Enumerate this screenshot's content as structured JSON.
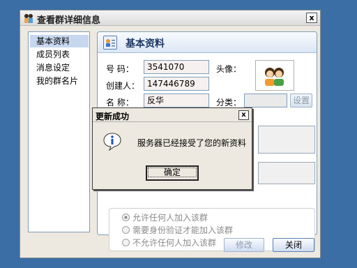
{
  "window": {
    "title": "查看群详细信息",
    "close_symbol": "x"
  },
  "nav": {
    "items": [
      "基本资料",
      "成员列表",
      "消息设定",
      "我的群名片"
    ]
  },
  "panel": {
    "title": "基本资料",
    "group_number_label": "号   码：",
    "group_number_value": "3541070",
    "creator_label": "创建人：",
    "creator_value": "147446789",
    "name_label": "名   称：",
    "name_value": "反华",
    "avatar_label": "头像：",
    "category_label": "分类：",
    "category_value": "",
    "settings_button": "设置",
    "join_options": [
      "允许任何人加入该群",
      "需要身份验证才能加入该群",
      "不允许任何人加入该群"
    ]
  },
  "buttons": {
    "modify": "修改",
    "close": "关闭"
  },
  "dialog": {
    "title": "更新成功",
    "close_symbol": "x",
    "message": "服务器已经接受了您的新资料",
    "ok_label": "确定",
    "icon": "info-icon"
  },
  "colors": {
    "desktop": "#3a6ea5",
    "accent": "#1f3a66",
    "nav_selected": "#c7d7f0"
  }
}
